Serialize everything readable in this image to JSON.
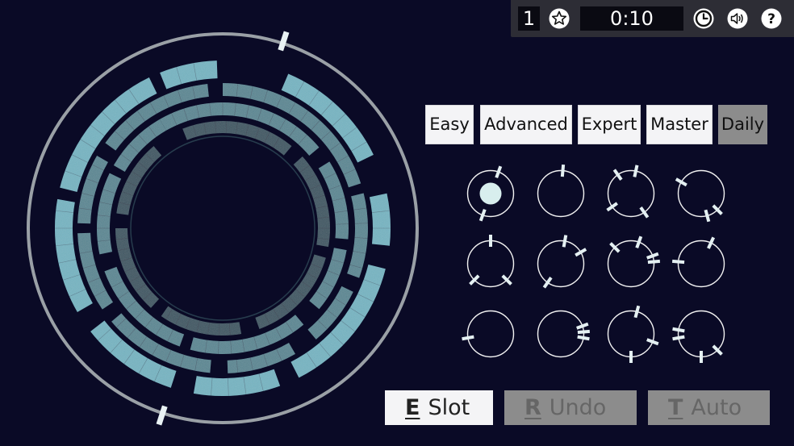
{
  "topbar": {
    "level": "1",
    "timer": "0:10",
    "icons": [
      "star-icon",
      "clock-icon",
      "speaker-icon",
      "help-icon"
    ]
  },
  "difficulties": [
    {
      "label": "Easy",
      "enabled": true
    },
    {
      "label": "Advanced",
      "enabled": true
    },
    {
      "label": "Expert",
      "enabled": true
    },
    {
      "label": "Master",
      "enabled": true
    },
    {
      "label": "Daily",
      "enabled": false
    }
  ],
  "actions": {
    "slot": {
      "key": "E",
      "label": "Slot",
      "enabled": true
    },
    "undo": {
      "key": "R",
      "label": "Undo",
      "enabled": false
    },
    "auto": {
      "key": "T",
      "label": "Auto",
      "enabled": false
    }
  },
  "colors": {
    "background": "#0a0a26",
    "ring_outer": "#9aa0a6",
    "segment_bright": "#6fb4c2",
    "segment_mid": "#4f8390",
    "segment_dim": "#3b5e68",
    "button_light": "#f4f4f6",
    "button_disabled": "#8c8c8c"
  },
  "pieces": [
    {
      "filled": true,
      "ticks": [
        20,
        200
      ]
    },
    {
      "filled": false,
      "ticks": [
        5
      ]
    },
    {
      "filled": false,
      "ticks": [
        12,
        325,
        145,
        235
      ]
    },
    {
      "filled": false,
      "ticks": [
        300,
        165,
        135
      ]
    },
    {
      "filled": false,
      "ticks": [
        0,
        225,
        135
      ]
    },
    {
      "filled": false,
      "ticks": [
        10,
        60,
        215
      ]
    },
    {
      "filled": false,
      "ticks": [
        20,
        70,
        85,
        315
      ]
    },
    {
      "filled": false,
      "ticks": [
        25,
        275
      ]
    },
    {
      "filled": false,
      "ticks": [
        260
      ]
    },
    {
      "filled": false,
      "ticks": [
        70,
        85,
        100
      ]
    },
    {
      "filled": false,
      "ticks": [
        15,
        110,
        180
      ]
    },
    {
      "filled": false,
      "ticks": [
        260,
        280,
        180,
        135
      ]
    }
  ]
}
